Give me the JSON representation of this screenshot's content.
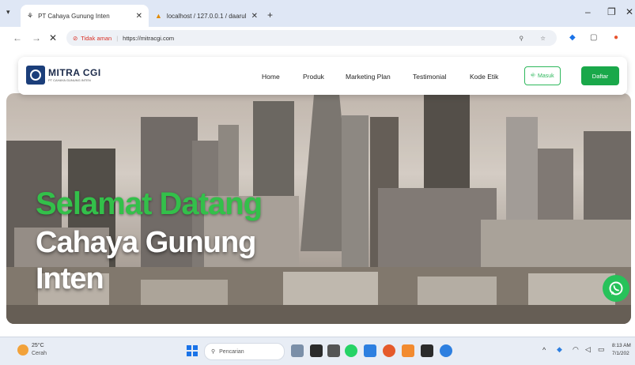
{
  "browser": {
    "tabs": [
      {
        "title": "PT Cahaya Gunung Inten",
        "active": true
      },
      {
        "title": "localhost / 127.0.0.1 / daarul /",
        "active": false
      }
    ],
    "security_label": "Tidak aman",
    "url": "https://mitracgi.com"
  },
  "site": {
    "brand": "MITRA CGI",
    "brand_sub": "PT CAHAYA GUNUNG INTEN",
    "nav": [
      "Home",
      "Produk",
      "Marketing Plan",
      "Testimonial",
      "Kode Etik"
    ],
    "login_label": "Masuk",
    "register_label": "Daftar"
  },
  "hero": {
    "line1": "Selamat Datang",
    "line2": "Cahaya Gunung",
    "line3": "Inten"
  },
  "taskbar": {
    "weather_temp": "25°C",
    "weather_desc": "Cerah",
    "search_placeholder": "Pencarian",
    "time": "8:13 AM",
    "date": "7/1/202"
  },
  "colors": {
    "accent": "#1aa84a",
    "hero_green": "#33c04a",
    "whatsapp": "#27c25a"
  }
}
